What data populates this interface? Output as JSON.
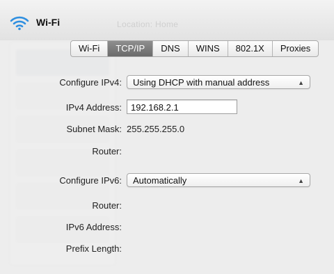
{
  "window": {
    "title": "Wi-Fi",
    "location_label": "Location: Home"
  },
  "tabs": [
    {
      "label": "Wi-Fi",
      "active": false
    },
    {
      "label": "TCP/IP",
      "active": true
    },
    {
      "label": "DNS",
      "active": false
    },
    {
      "label": "WINS",
      "active": false
    },
    {
      "label": "802.1X",
      "active": false
    },
    {
      "label": "Proxies",
      "active": false
    }
  ],
  "ipv4": {
    "configure_label": "Configure IPv4:",
    "configure_value": "Using DHCP with manual address",
    "address_label": "IPv4 Address:",
    "address_value": "192.168.2.1",
    "subnet_label": "Subnet Mask:",
    "subnet_value": "255.255.255.0",
    "router_label": "Router:",
    "router_value": ""
  },
  "ipv6": {
    "configure_label": "Configure IPv6:",
    "configure_value": "Automatically",
    "router_label": "Router:",
    "router_value": "",
    "address_label": "IPv6 Address:",
    "address_value": "",
    "prefix_label": "Prefix Length:",
    "prefix_value": ""
  },
  "colors": {
    "active_tab": "#7a7a7a",
    "wifi_icon": "#2f8fe0"
  }
}
